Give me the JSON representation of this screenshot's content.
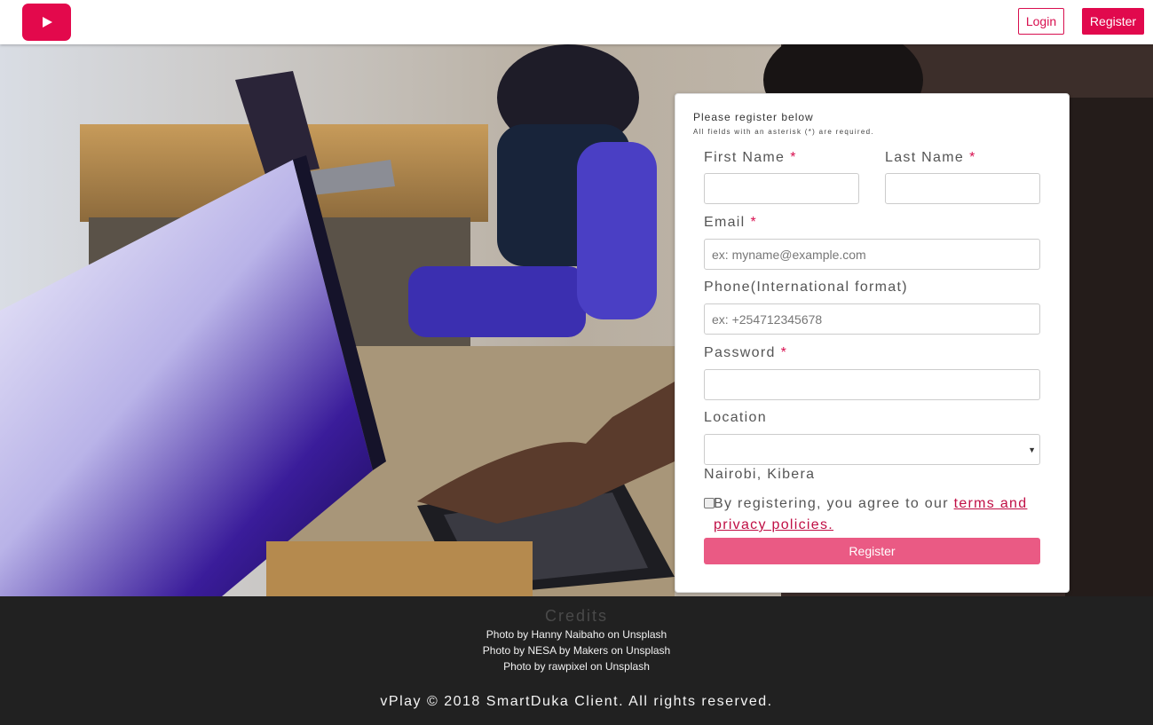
{
  "header": {
    "logo_icon": "play-icon",
    "login_label": "Login",
    "register_label": "Register"
  },
  "colors": {
    "brand": "#e3094c",
    "submit": "#ea5a84",
    "footer_bg": "#212121"
  },
  "form": {
    "title": "Please register below",
    "subtitle": "All fields with an asterisk (*) are required.",
    "required_mark": "*",
    "first_name": {
      "label": "First Name",
      "value": ""
    },
    "last_name": {
      "label": "Last Name",
      "value": ""
    },
    "email": {
      "label": "Email",
      "placeholder": "ex: myname@example.com"
    },
    "phone": {
      "label": "Phone(International format)",
      "placeholder": "ex: +254712345678"
    },
    "password": {
      "label": "Password",
      "value": ""
    },
    "location": {
      "label": "Location",
      "selected": "",
      "text": "Nairobi, Kibera"
    },
    "agree_text": "By registering, you agree to our",
    "agree_link": "terms and privacy policies.",
    "submit_label": "Register"
  },
  "footer": {
    "credits_title": "Credits",
    "credits": [
      "Photo by Hanny Naibaho on Unsplash",
      "Photo by NESA by Makers on Unsplash",
      "Photo by rawpixel on Unsplash"
    ],
    "copyright": "vPlay © 2018 SmartDuka Client. All rights reserved."
  }
}
